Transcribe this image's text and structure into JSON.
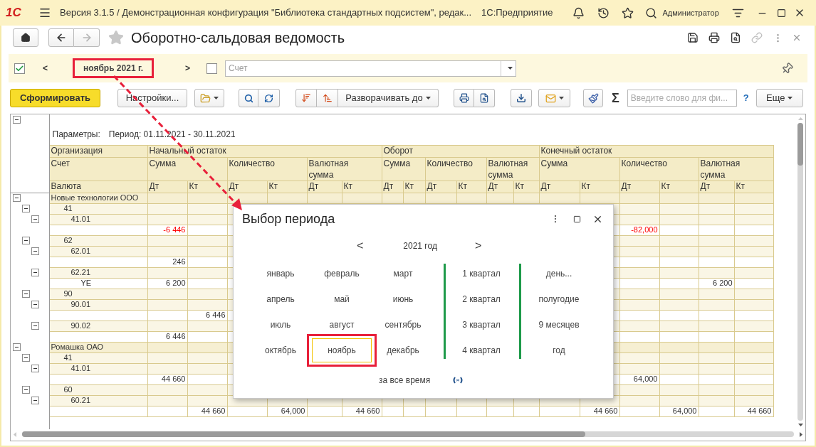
{
  "app_bar": {
    "logo": "1С",
    "title": "Версия 3.1.5 / Демонстрационная конфигурация \"Библиотека стандартных подсистем\", редак...",
    "product": "1С:Предприятие",
    "user": "Администратор"
  },
  "window": {
    "title": "Оборотно-сальдовая ведомость",
    "nav": [
      {
        "kind": "back",
        "disabled": false
      },
      {
        "kind": "forward",
        "disabled": true
      }
    ],
    "link_disabled": true
  },
  "filter": {
    "period_checked": true,
    "prev": "<",
    "period": "ноябрь 2021 г.",
    "period_highlighted": true,
    "next": ">",
    "account_checked": false,
    "account_placeholder": "Счет"
  },
  "toolbar": {
    "generate": "Сформировать",
    "settings": "Настройки...",
    "expand_to": "Разворачивать до",
    "sum_sign": "Σ",
    "search_placeholder": "Введите слово для фи...",
    "help": "?",
    "more": "Еще"
  },
  "report": {
    "params_expanded": true,
    "params_label": "Параметры:",
    "period_text": "Период: 01.11.2021 - 30.11.2021",
    "columns": {
      "org": "Организация",
      "account": "Счет",
      "currency": "Валюта",
      "groups": [
        {
          "title": "Начальный остаток",
          "measures": [
            {
              "title": "Сумма",
              "dt": "Дт",
              "kt": "Кт"
            },
            {
              "title": "Количество",
              "dt": "Дт",
              "kt": "Кт"
            },
            {
              "title": "Валютная сумма",
              "dt": "Дт",
              "kt": "Кт"
            }
          ]
        },
        {
          "title": "Оборот",
          "measures": [
            {
              "title": "Сумма",
              "dt": "Дт",
              "kt": "Кт"
            },
            {
              "title": "Количество",
              "dt": "Дт",
              "kt": "Кт"
            },
            {
              "title": "Валютная сумма",
              "dt": "Дт",
              "kt": "Кт"
            }
          ]
        },
        {
          "title": "Конечный остаток",
          "measures": [
            {
              "title": "Сумма",
              "dt": "Дт",
              "kt": "Кт"
            },
            {
              "title": "Количество",
              "dt": "Дт",
              "kt": "Кт"
            },
            {
              "title": "Валютная сумма",
              "dt": "Дт",
              "kt": "Кт"
            }
          ]
        }
      ]
    },
    "rows": [
      {
        "label": "Новые технологии ООО",
        "expanded": true,
        "children": [
          {
            "label": "41",
            "expanded": true,
            "children": [
              {
                "label": "41.01",
                "expanded": true,
                "children": [
                  {
                    "values": {
                      "opening_sum_dt": {
                        "text": "-6 446",
                        "negative": true
                      },
                      "closing_qty_dt": {
                        "text": "-82,000",
                        "negative": true
                      }
                    }
                  }
                ]
              }
            ]
          },
          {
            "label": "62",
            "expanded": true,
            "children": [
              {
                "label": "62.01",
                "expanded": true,
                "children": [
                  {
                    "values": {
                      "opening_sum_dt": {
                        "text": "246",
                        "negative": false
                      }
                    }
                  }
                ]
              },
              {
                "label": "62.21",
                "expanded": true,
                "children": [
                  {
                    "label": "YE",
                    "values": {
                      "opening_sum_dt": {
                        "text": "6 200",
                        "negative": false
                      },
                      "closing_cur_dt": {
                        "text": "6 200",
                        "negative": false
                      }
                    }
                  }
                ]
              }
            ]
          },
          {
            "label": "90",
            "expanded": true,
            "children": [
              {
                "label": "90.01",
                "expanded": true,
                "children": [
                  {
                    "values": {
                      "opening_sum_kt": {
                        "text": "6 446",
                        "negative": false
                      }
                    }
                  }
                ]
              },
              {
                "label": "90.02",
                "expanded": true,
                "children": [
                  {
                    "values": {
                      "opening_sum_dt": {
                        "text": "6 446",
                        "negative": false
                      }
                    }
                  }
                ]
              }
            ]
          }
        ]
      },
      {
        "label": "Ромашка ОАО",
        "expanded": true,
        "children": [
          {
            "label": "41",
            "expanded": true,
            "children": [
              {
                "label": "41.01",
                "expanded": true,
                "children": [
                  {
                    "values": {
                      "opening_sum_dt": {
                        "text": "44 660",
                        "negative": false
                      },
                      "closing_qty_dt": {
                        "text": "64,000",
                        "negative": false
                      }
                    }
                  }
                ]
              }
            ]
          },
          {
            "label": "60",
            "expanded": true,
            "children": [
              {
                "label": "60.21",
                "expanded": true,
                "children": [
                  {
                    "values": {
                      "opening_sum_kt": {
                        "text": "44 660",
                        "negative": false
                      },
                      "opening_qty_kt": {
                        "text": "64,000",
                        "negative": false
                      },
                      "opening_cur_kt": {
                        "text": "44 660",
                        "negative": false
                      },
                      "closing_sum_kt": {
                        "text": "44 660",
                        "negative": false
                      },
                      "closing_qty_kt": {
                        "text": "64,000",
                        "negative": false
                      },
                      "closing_cur_kt": {
                        "text": "44 660",
                        "negative": false
                      }
                    }
                  }
                ]
              }
            ]
          }
        ]
      }
    ]
  },
  "period_dialog": {
    "title": "Выбор периода",
    "prev": "<",
    "year": "2021 год",
    "next": ">",
    "months": [
      {
        "label": "январь",
        "selected": false,
        "highlighted": false
      },
      {
        "label": "февраль",
        "selected": false,
        "highlighted": false
      },
      {
        "label": "март",
        "selected": false,
        "highlighted": false
      },
      {
        "label": "апрель",
        "selected": false,
        "highlighted": false
      },
      {
        "label": "май",
        "selected": false,
        "highlighted": false
      },
      {
        "label": "июнь",
        "selected": false,
        "highlighted": false
      },
      {
        "label": "июль",
        "selected": false,
        "highlighted": false
      },
      {
        "label": "август",
        "selected": false,
        "highlighted": false
      },
      {
        "label": "сентябрь",
        "selected": false,
        "highlighted": false
      },
      {
        "label": "октябрь",
        "selected": false,
        "highlighted": false
      },
      {
        "label": "ноябрь",
        "selected": true,
        "highlighted": true
      },
      {
        "label": "декабрь",
        "selected": false,
        "highlighted": false
      }
    ],
    "quarters": [
      {
        "label": "1 квартал",
        "selected": false
      },
      {
        "label": "2 квартал",
        "selected": false
      },
      {
        "label": "3 квартал",
        "selected": false
      },
      {
        "label": "4 квартал",
        "selected": false
      }
    ],
    "periods": [
      {
        "label": "день...",
        "selected": false
      },
      {
        "label": "полугодие",
        "selected": false
      },
      {
        "label": "9 месяцев",
        "selected": false
      },
      {
        "label": "год",
        "selected": false
      }
    ],
    "all_time": "за все время"
  }
}
